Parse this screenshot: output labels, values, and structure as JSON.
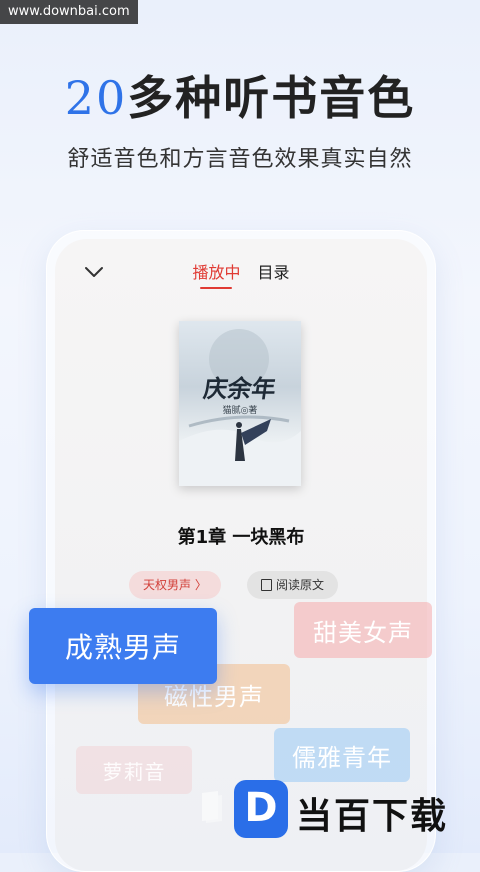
{
  "watermark": "www.downbai.com",
  "headline": {
    "num": "20",
    "text": "多种听书音色"
  },
  "subline": "舒适音色和方言音色效果真实自然",
  "player": {
    "tabs": [
      "播放中",
      "目录"
    ],
    "cover": {
      "title": "庆余年",
      "author": "猫腻◎著"
    },
    "chapter": "第1章 一块黑布",
    "voice_chip": "天权男声 〉",
    "read_chip": "阅读原文"
  },
  "voice_tags": [
    "成熟男声",
    "甜美女声",
    "磁性男声",
    "儒雅青年",
    "萝莉音"
  ],
  "brand": {
    "logo": "D",
    "text": "当百下载"
  },
  "colors": {
    "accent": "#2f73e8",
    "active_tab": "#e03a33"
  }
}
